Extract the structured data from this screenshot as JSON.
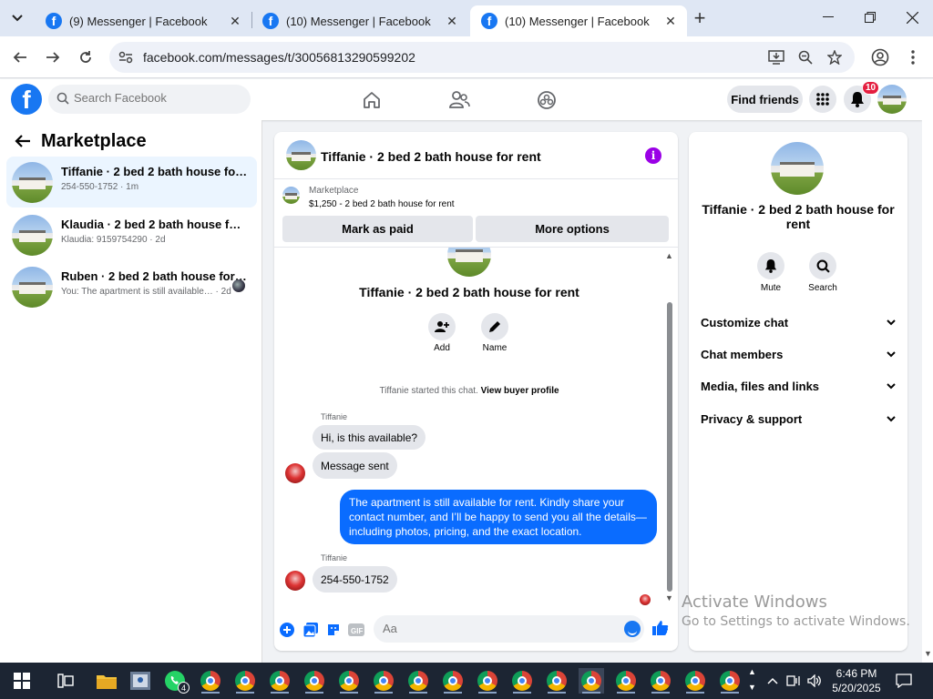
{
  "browser": {
    "tabs": [
      {
        "title": "(9) Messenger | Facebook",
        "active": false
      },
      {
        "title": "(10) Messenger | Facebook",
        "active": false
      },
      {
        "title": "(10) Messenger | Facebook",
        "active": true
      }
    ],
    "url": "facebook.com/messages/t/30056813290599202"
  },
  "fb_header": {
    "search_placeholder": "Search Facebook",
    "find_friends": "Find friends",
    "notification_count": "10"
  },
  "left_pane": {
    "title": "Marketplace",
    "conversations": [
      {
        "name": "Tiffanie · 2 bed 2 bath house for rent",
        "sub": "254-550-1752 · 1m",
        "active": true
      },
      {
        "name": "Klaudia · 2 bed 2 bath house for rent",
        "sub": "Klaudia: 9159754290 · 2d",
        "active": false
      },
      {
        "name": "Ruben · 2 bed 2 bath house for rent",
        "sub": "You: The apartment is still available…  · 2d",
        "active": false
      }
    ]
  },
  "chat": {
    "title": "Tiffanie · 2 bed 2 bath house for rent",
    "marketplace_label": "Marketplace",
    "listing": "$1,250 - 2 bed 2 bath house for rent",
    "mark_as_paid": "Mark as paid",
    "more_options": "More options",
    "intro_name": "Tiffanie · 2 bed 2 bath house for rent",
    "add_label": "Add",
    "name_label": "Name",
    "started_text": "Tiffanie started this chat.",
    "view_buyer_profile": "View buyer profile",
    "messages": [
      {
        "sender": "Tiffanie",
        "text": "Hi, is this available?"
      },
      {
        "text": "Message sent"
      },
      {
        "from_me": true,
        "text": "The apartment is still available for rent. Kindly share your contact number, and I’ll be happy to send you all the details—including photos, pricing, and the exact location."
      },
      {
        "sender": "Tiffanie",
        "text": "254-550-1752"
      }
    ],
    "composer_placeholder": "Aa"
  },
  "right_pane": {
    "name": "Tiffanie · 2 bed 2 bath house for rent",
    "mute": "Mute",
    "search": "Search",
    "sections": [
      "Customize chat",
      "Chat members",
      "Media, files and links",
      "Privacy & support"
    ]
  },
  "watermark": {
    "line1": "Activate Windows",
    "line2": "Go to Settings to activate Windows."
  },
  "taskbar": {
    "time": "6:46 PM",
    "date": "5/20/2025",
    "whatsapp_badge": "4"
  },
  "colors": {
    "facebook_blue": "#1877f2",
    "message_out": "#0a6cff",
    "info_purple": "#9a00e6",
    "badge_red": "#e41e3f"
  }
}
